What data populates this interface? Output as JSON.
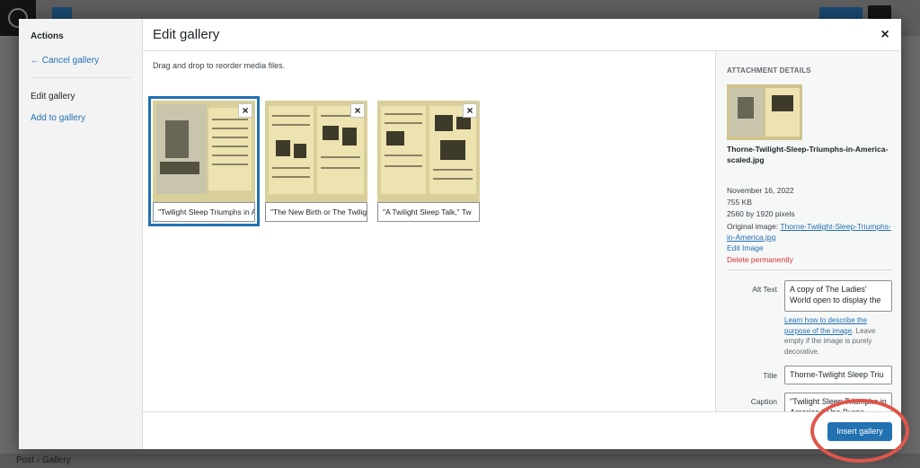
{
  "modal": {
    "title": "Edit gallery",
    "close_symbol": "×"
  },
  "menu": {
    "heading": "Actions",
    "cancel": "← Cancel gallery",
    "edit": "Edit gallery",
    "add": "Add to gallery"
  },
  "instructions": "Drag and drop to reorder media files.",
  "gallery": [
    {
      "caption": "\"Twilight Sleep Triumphs in America,\"",
      "selected": true
    },
    {
      "caption": "\"The New Birth or The Twilight Sleep\"",
      "selected": false
    },
    {
      "caption": "\"A Twilight Sleep Talk,\" Tw",
      "selected": false
    }
  ],
  "remove_symbol": "×",
  "details": {
    "heading": "Attachment Details",
    "filename": "Thorne-Twilight-Sleep-Triumphs-in-America-scaled.jpg",
    "date": "November 16, 2022",
    "size": "755 KB",
    "dimensions": "2560 by 1920 pixels",
    "original_label": "Original image:",
    "original_link": "Thorne-Twilight-Sleep-Triumphs-in-America.jpg",
    "edit_image": "Edit Image",
    "delete": "Delete permanently",
    "alt_label": "Alt Text",
    "alt_value": "A copy of The Ladies' World open to display the",
    "learn_link": "Learn how to describe the purpose of the image",
    "learn_rest": ". Leave empty if the image is purely decorative.",
    "title_label": "Title",
    "title_value": "Thorne-Twilight Sleep Triu",
    "caption_label": "Caption",
    "caption_value": "\"Twilight Sleep Triumphs in America,\" Van Buren Thorne, The Ladies'"
  },
  "toolbar": {
    "insert": "Insert gallery"
  },
  "background": {
    "breadcrumb": "Post  ›  Gallery"
  },
  "colors": {
    "accent": "#2271b1",
    "danger": "#d63638",
    "highlight": "#e0564b"
  }
}
